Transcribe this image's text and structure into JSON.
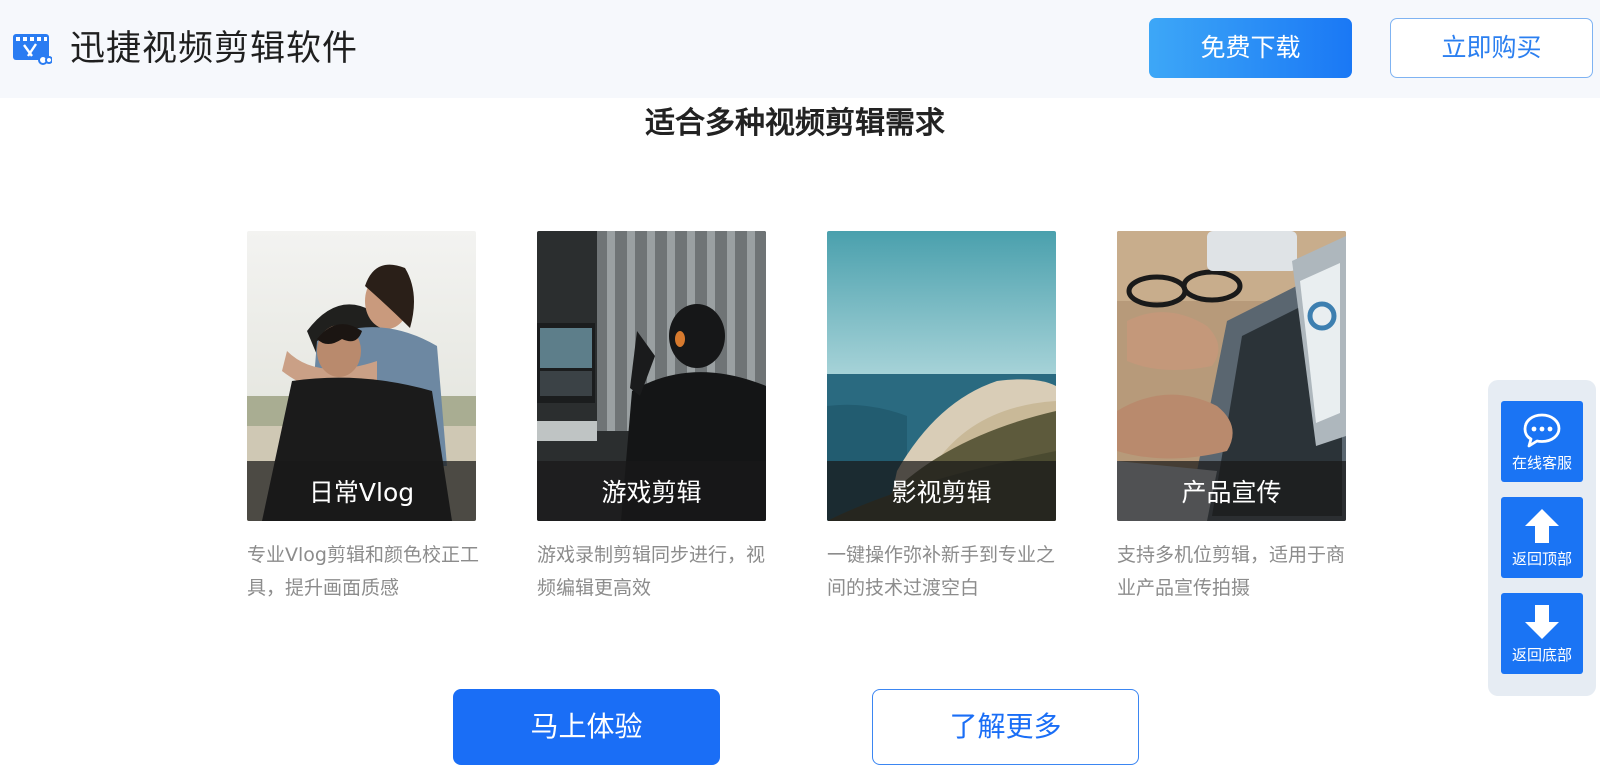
{
  "header": {
    "title": "迅捷视频剪辑软件",
    "logo_icon": "video-editor-logo-icon",
    "download_label": "免费下载",
    "buy_label": "立即购买"
  },
  "section": {
    "title": "适合多种视频剪辑需求"
  },
  "cards": [
    {
      "caption": "日常Vlog",
      "description": "专业Vlog剪辑和颜色校正工具，提升画面质感"
    },
    {
      "caption": "游戏剪辑",
      "description": "游戏录制剪辑同步进行，视频编辑更高效"
    },
    {
      "caption": "影视剪辑",
      "description": "一键操作弥补新手到专业之间的技术过渡空白"
    },
    {
      "caption": "产品宣传",
      "description": "支持多机位剪辑，适用于商业产品宣传拍摄"
    }
  ],
  "cta": {
    "try_label": "马上体验",
    "more_label": "了解更多"
  },
  "side_panel": {
    "items": [
      {
        "label": "在线客服",
        "icon": "chat-bubble-icon"
      },
      {
        "label": "返回顶部",
        "icon": "arrow-up-icon"
      },
      {
        "label": "返回底部",
        "icon": "arrow-down-icon"
      }
    ]
  },
  "colors": {
    "primary": "#1a6ef6",
    "header_bg": "#f6f8fc",
    "text_muted": "#8c8c8c"
  }
}
